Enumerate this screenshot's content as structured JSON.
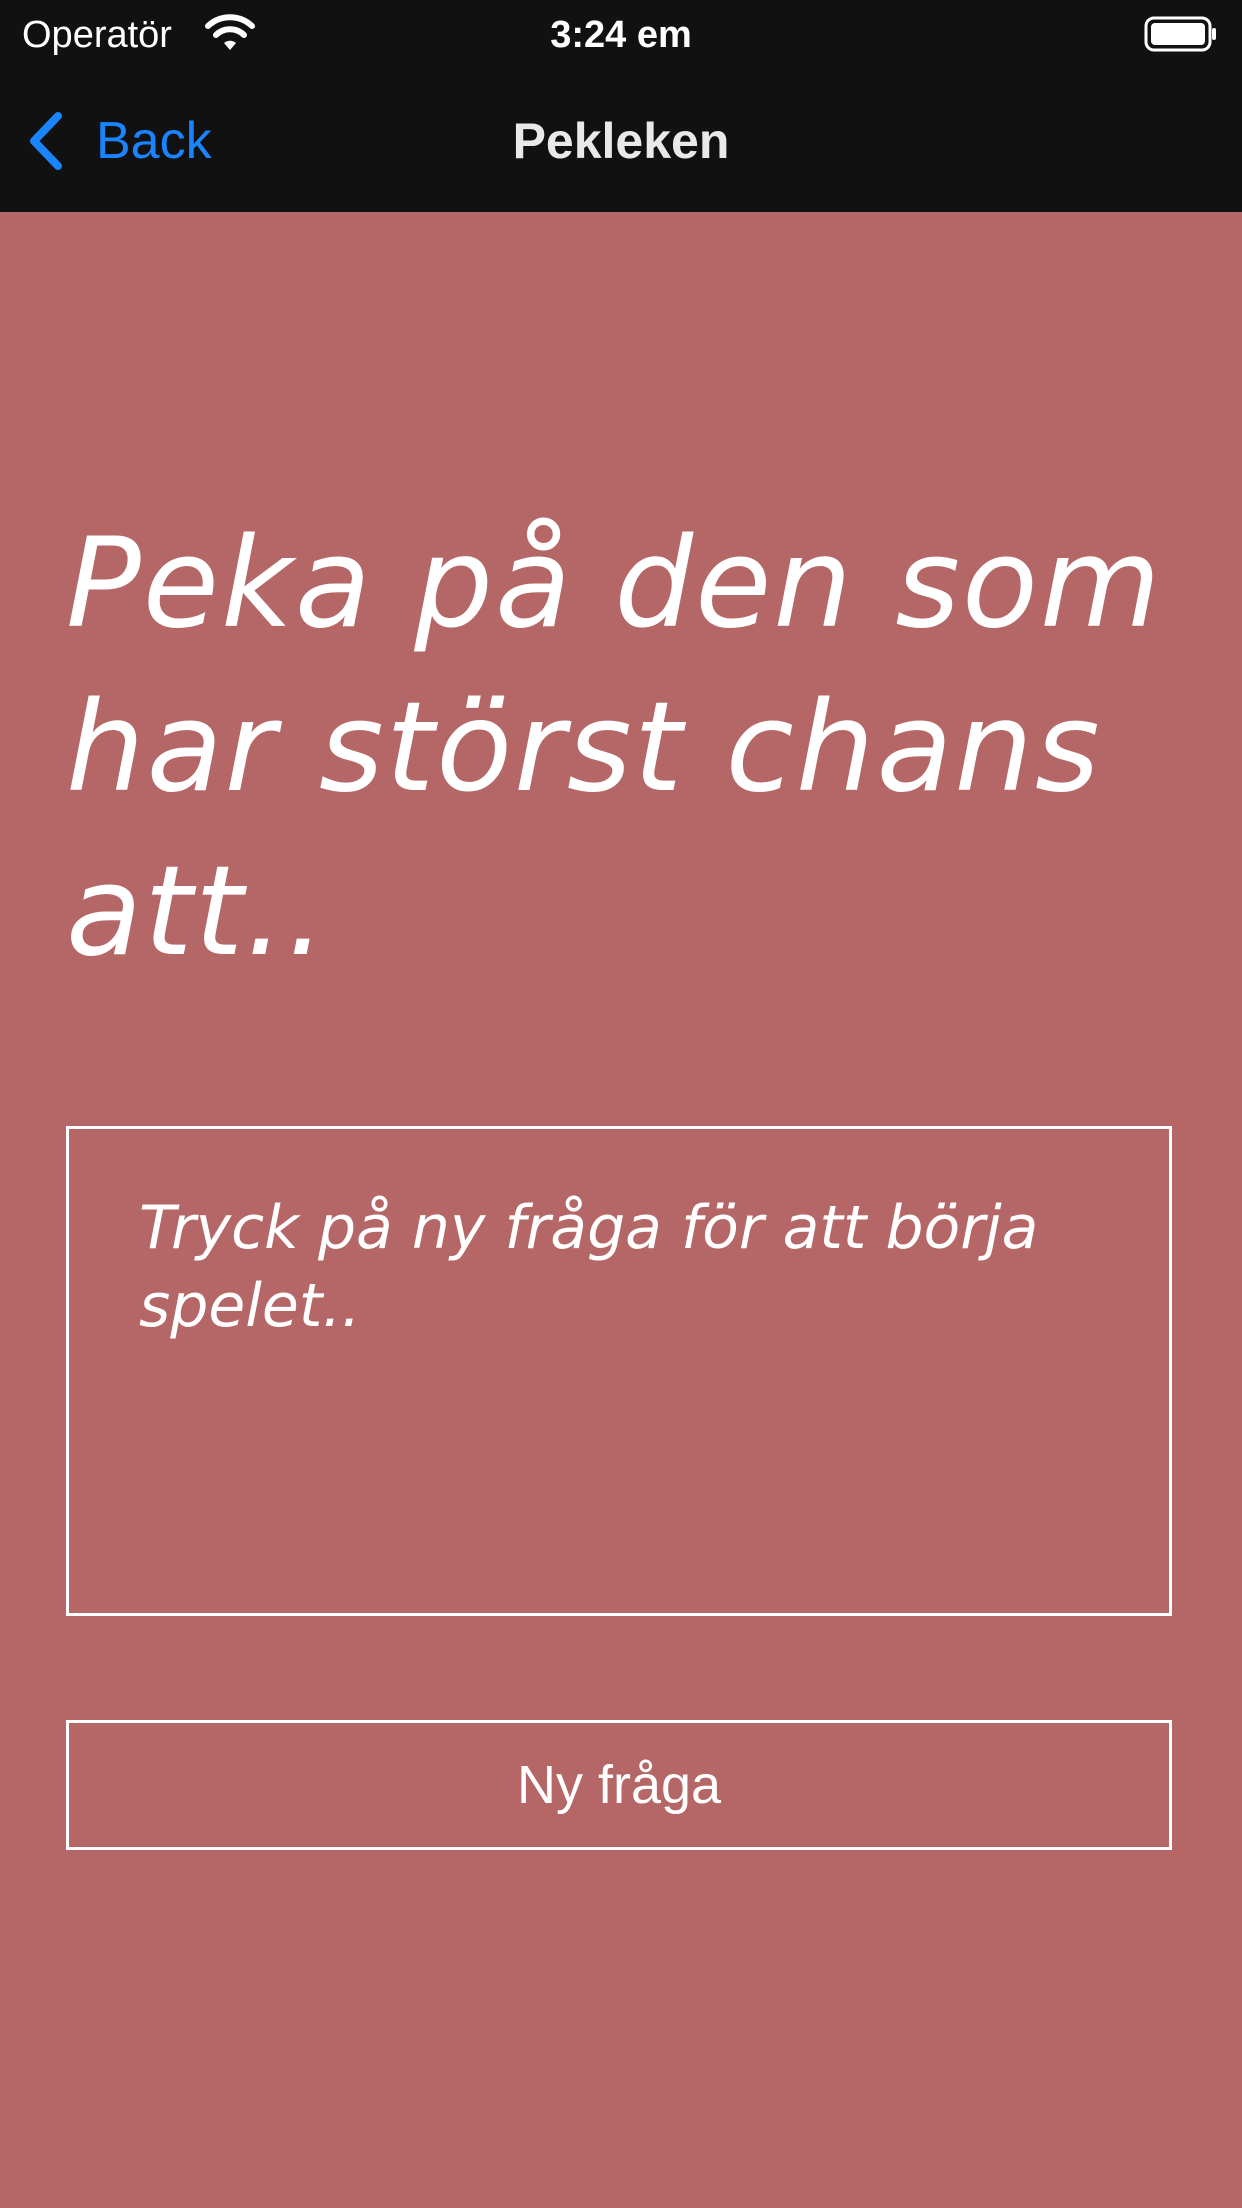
{
  "status_bar": {
    "carrier": "Operatör",
    "time": "3:24 em",
    "wifi_icon": "wifi-icon",
    "battery_icon": "battery-icon"
  },
  "nav": {
    "back_label": "Back",
    "back_icon": "chevron-left-icon",
    "title": "Pekleken"
  },
  "main": {
    "heading": "Peka på den som har störst chans att..",
    "question_text": " Tryck på ny fråga för att börja spelet..",
    "new_question_label": "Ny fråga"
  },
  "colors": {
    "background": "#b56666",
    "bar": "#111111",
    "accent": "#1a84ff",
    "text": "#ffffff"
  }
}
